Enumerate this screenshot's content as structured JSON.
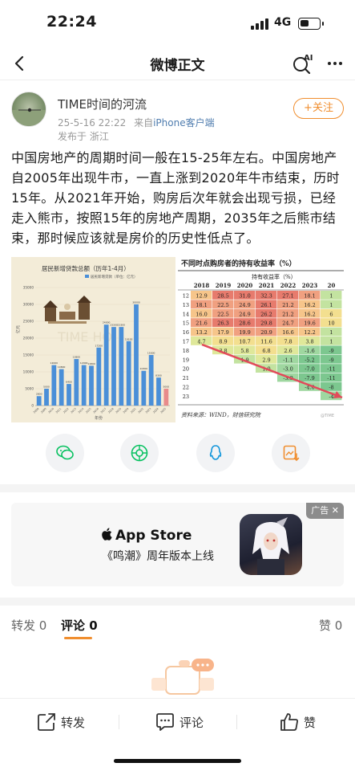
{
  "status_bar": {
    "time": "22:24",
    "network": "4G",
    "battery_level": 0.45
  },
  "nav": {
    "title": "微博正文",
    "ai_label": "AI",
    "icons": [
      "back-icon",
      "ai-search-icon",
      "more-icon"
    ]
  },
  "author": {
    "name": "TIME时间的河流",
    "date": "25-5-16 22:22",
    "source_prefix": "来自",
    "source": "iPhone客户端",
    "location": "发布于 浙江",
    "follow_label": "+关注"
  },
  "post": {
    "text": "中国房地产的周期时间一般在15-25年左右。中国房地产自2005年出现牛市，一直上涨到2020年牛市结束，历时15年。从2021年开始，购房后次年就会出现亏损，已经走入熊市，按照15年的房地产周期，2035年之后熊市结束，那时候应该就是房价的历史性低点了。"
  },
  "left_image": {
    "title": "居民新增贷款总额（历年1-4月）",
    "legend": "居民新增贷款（单位：亿元）",
    "ylabel": "亿元",
    "xlabel": "年份",
    "watermark": "TIME HO",
    "chart_data": {
      "type": "bar",
      "title": "居民新增贷款总额（历年1-4月）",
      "xlabel": "年份",
      "ylabel": "亿元",
      "categories": [
        "2008",
        "2009",
        "2010",
        "2011",
        "2012",
        "2013",
        "2014",
        "2015",
        "2016",
        "2017",
        "2018",
        "2019",
        "2020",
        "2021",
        "2022",
        "2023",
        "2024",
        "2025"
      ],
      "values": [
        2800,
        5000,
        12000,
        10800,
        6400,
        13800,
        12000,
        11800,
        17200,
        24000,
        23300,
        23300,
        19100,
        30000,
        10300,
        15000,
        8300,
        5000
      ],
      "y_ticks": [
        "0",
        "5000",
        "10000",
        "15000",
        "20000",
        "25000",
        "30000",
        "35000"
      ],
      "ylim": [
        0,
        35000
      ]
    }
  },
  "right_image": {
    "title": "不同时点购房者的持有收益率（%）",
    "header_label": "持有收益率（%）",
    "years": [
      "2018",
      "2019",
      "2020",
      "2021",
      "2022",
      "2023",
      "20"
    ],
    "rows": [
      {
        "year": "2012",
        "cells": [
          "12.9",
          "28.5",
          "31.0",
          "32.3",
          "27.1",
          "18.1",
          "1"
        ]
      },
      {
        "year": "2013",
        "cells": [
          "18.1",
          "22.5",
          "24.9",
          "26.1",
          "21.2",
          "16.2",
          "1"
        ]
      },
      {
        "year": "2014",
        "cells": [
          "16.0",
          "22.5",
          "24.9",
          "26.2",
          "21.2",
          "16.2",
          "6"
        ]
      },
      {
        "year": "2015",
        "cells": [
          "21.6",
          "26.3",
          "28.6",
          "29.8",
          "24.7",
          "19.6",
          "10"
        ]
      },
      {
        "year": "2016",
        "cells": [
          "13.2",
          "17.9",
          "19.9",
          "20.9",
          "16.6",
          "12.2",
          "1"
        ]
      },
      {
        "year": "2017",
        "cells": [
          "4.7",
          "8.9",
          "10.7",
          "11.6",
          "7.8",
          "3.8",
          "1"
        ]
      },
      {
        "year": "2018",
        "cells": [
          "",
          "3.8",
          "5.8",
          "6.8",
          "2.6",
          "-1.6",
          "-9"
        ]
      },
      {
        "year": "2019",
        "cells": [
          "",
          "",
          "1.9",
          "2.9",
          "-1.1",
          "-5.2",
          "-9"
        ]
      },
      {
        "year": "2020",
        "cells": [
          "",
          "",
          "",
          "1.0",
          "-3.0",
          "-7.0",
          "-11"
        ]
      },
      {
        "year": "2021",
        "cells": [
          "",
          "",
          "",
          "",
          "-3.9",
          "-7.9",
          "-11"
        ]
      },
      {
        "year": "2022",
        "cells": [
          "",
          "",
          "",
          "",
          "",
          "-4.0",
          "-8"
        ]
      },
      {
        "year": "2023",
        "cells": [
          "",
          "",
          "",
          "",
          "",
          "",
          "-4"
        ]
      }
    ],
    "source": "资料来源：WIND，财信研究院",
    "watermark": "@TIME"
  },
  "share": {
    "icons": [
      "wechat-icon",
      "moments-icon",
      "qq-icon",
      "save-image-icon"
    ],
    "colors": [
      "#07c160",
      "#07c160",
      "#1296db",
      "#f08e2f"
    ]
  },
  "ad": {
    "tag": "广告",
    "brand": "App Store",
    "subtitle": "《鸣潮》周年版本上线"
  },
  "tabs": {
    "repost": "转发 0",
    "comment": "评论 0",
    "like": "赞 0"
  },
  "bottom_bar": {
    "repost": "转发",
    "comment": "评论",
    "like": "赞"
  },
  "colors": {
    "accent": "#f08e2f",
    "link": "#507daf"
  }
}
